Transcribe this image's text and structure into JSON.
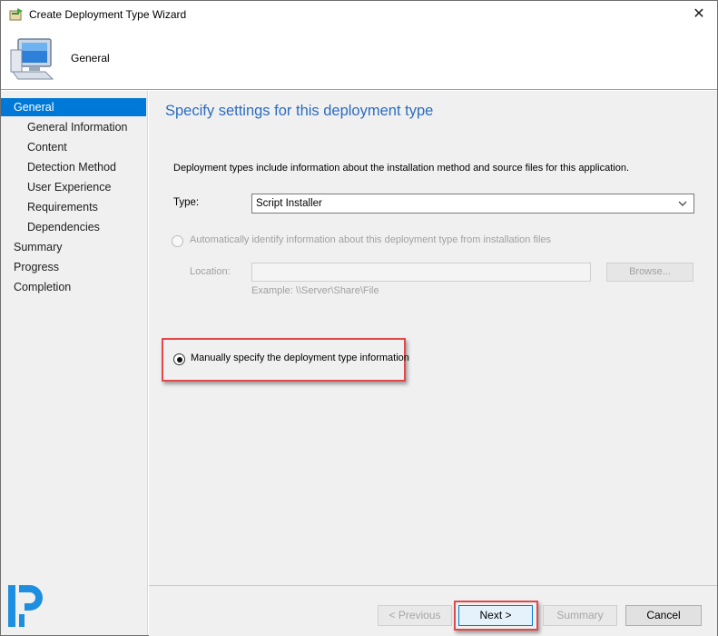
{
  "window": {
    "title": "Create Deployment Type Wizard",
    "close_glyph": "✕"
  },
  "header": {
    "title": "General",
    "icon": "computer-icon"
  },
  "nav": {
    "items": [
      {
        "label": "General",
        "level": "top",
        "selected": true
      },
      {
        "label": "General Information",
        "level": "sub",
        "selected": false
      },
      {
        "label": "Content",
        "level": "sub",
        "selected": false
      },
      {
        "label": "Detection Method",
        "level": "sub",
        "selected": false
      },
      {
        "label": "User Experience",
        "level": "sub",
        "selected": false
      },
      {
        "label": "Requirements",
        "level": "sub",
        "selected": false
      },
      {
        "label": "Dependencies",
        "level": "sub",
        "selected": false
      },
      {
        "label": "Summary",
        "level": "top",
        "selected": false
      },
      {
        "label": "Progress",
        "level": "top",
        "selected": false
      },
      {
        "label": "Completion",
        "level": "top",
        "selected": false
      }
    ],
    "logo": "brand-logo-icon"
  },
  "main": {
    "heading": "Specify settings for this deployment type",
    "description": "Deployment types include information about the installation method and source files for this application.",
    "type_label": "Type:",
    "type_value": "Script Installer",
    "auto_option_label": "Automatically identify information about this deployment type from installation files",
    "location_label": "Location:",
    "location_value": "",
    "browse_label": "Browse...",
    "example_text": "Example: \\\\Server\\Share\\File",
    "manual_option_label": "Manually specify the deployment type information"
  },
  "buttons": {
    "previous": "< Previous",
    "next": "Next >",
    "summary": "Summary",
    "cancel": "Cancel"
  },
  "colors": {
    "accent": "#0078d7",
    "heading": "#2a6cbf",
    "highlight": "#e0484a"
  }
}
